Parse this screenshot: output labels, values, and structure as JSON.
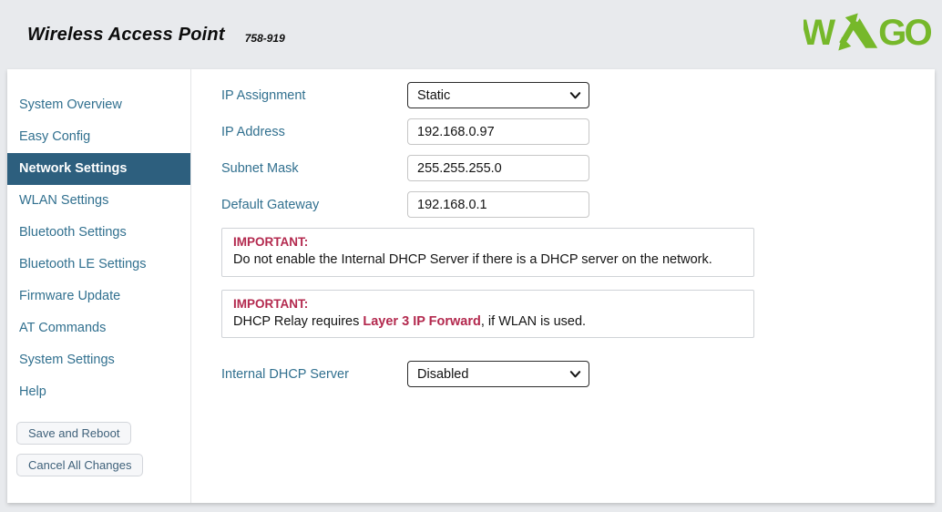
{
  "header": {
    "title": "Wireless Access Point",
    "model": "758-919",
    "logo_text": "WAGO"
  },
  "sidebar": {
    "items": [
      {
        "label": "System Overview",
        "selected": false
      },
      {
        "label": "Easy Config",
        "selected": false
      },
      {
        "label": "Network Settings",
        "selected": true
      },
      {
        "label": "WLAN Settings",
        "selected": false
      },
      {
        "label": "Bluetooth Settings",
        "selected": false
      },
      {
        "label": "Bluetooth LE Settings",
        "selected": false
      },
      {
        "label": "Firmware Update",
        "selected": false
      },
      {
        "label": "AT Commands",
        "selected": false
      },
      {
        "label": "System Settings",
        "selected": false
      },
      {
        "label": "Help",
        "selected": false
      }
    ],
    "save_button": "Save and Reboot",
    "cancel_button": "Cancel All Changes"
  },
  "form": {
    "ip_assignment": {
      "label": "IP Assignment",
      "value": "Static"
    },
    "ip_address": {
      "label": "IP Address",
      "value": "192.168.0.97"
    },
    "subnet_mask": {
      "label": "Subnet Mask",
      "value": "255.255.255.0"
    },
    "default_gateway": {
      "label": "Default Gateway",
      "value": "192.168.0.1"
    },
    "internal_dhcp_server": {
      "label": "Internal DHCP Server",
      "value": "Disabled"
    }
  },
  "notices": [
    {
      "title": "IMPORTANT:",
      "text": "Do not enable the Internal DHCP Server if there is a DHCP server on the network."
    },
    {
      "title": "IMPORTANT:",
      "text_before": "DHCP Relay requires ",
      "highlight": "Layer 3 IP Forward",
      "text_after": ", if WLAN is used."
    }
  ],
  "colors": {
    "wago_green": "#76b82a",
    "nav_selected_bg": "#2d5f7e",
    "important_red": "#b3294e",
    "link_blue": "#31708f"
  }
}
